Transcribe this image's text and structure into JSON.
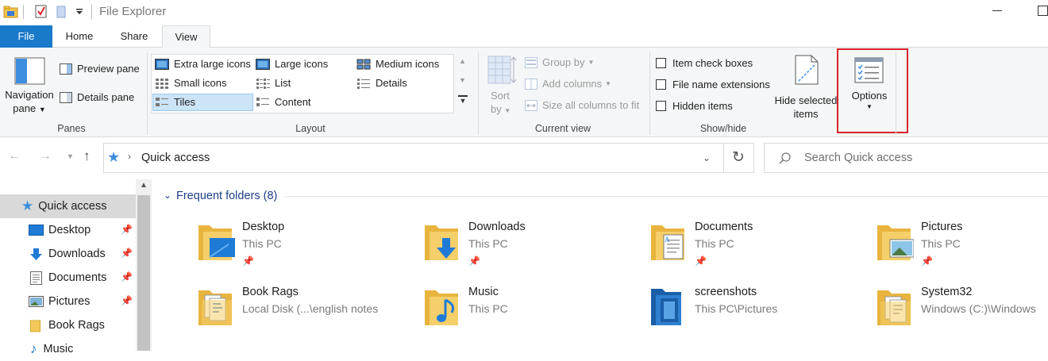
{
  "window": {
    "title": "File Explorer"
  },
  "tabs": [
    {
      "label": "File"
    },
    {
      "label": "Home"
    },
    {
      "label": "Share"
    },
    {
      "label": "View"
    }
  ],
  "ribbon": {
    "panes": {
      "nav_pane_line1": "Navigation",
      "nav_pane_line2": "pane",
      "preview_pane": "Preview pane",
      "details_pane": "Details pane",
      "group_label": "Panes"
    },
    "layout": {
      "items": [
        {
          "label": "Extra large icons"
        },
        {
          "label": "Large icons"
        },
        {
          "label": "Medium icons"
        },
        {
          "label": "Small icons"
        },
        {
          "label": "List"
        },
        {
          "label": "Details"
        },
        {
          "label": "Tiles"
        },
        {
          "label": "Content"
        }
      ],
      "selected": "Tiles",
      "group_label": "Layout"
    },
    "current_view": {
      "sort_line1": "Sort",
      "sort_line2": "by",
      "group_by": "Group by",
      "add_columns": "Add columns",
      "size_all_columns": "Size all columns to fit",
      "group_label": "Current view"
    },
    "show_hide": {
      "item_check_boxes": "Item check boxes",
      "file_name_extensions": "File name extensions",
      "hidden_items": "Hidden items",
      "hide_selected_line1": "Hide selected",
      "hide_selected_line2": "items",
      "group_label": "Show/hide"
    },
    "options": {
      "label": "Options"
    },
    "highlight_color": "#d9232e"
  },
  "address": {
    "path": "Quick access"
  },
  "search": {
    "placeholder": "Search Quick access"
  },
  "nav": {
    "items": [
      {
        "label": "Quick access",
        "icon": "star-icon"
      },
      {
        "label": "Desktop",
        "icon": "desktop-icon"
      },
      {
        "label": "Downloads",
        "icon": "download-arrow-icon"
      },
      {
        "label": "Documents",
        "icon": "documents-icon"
      },
      {
        "label": "Pictures",
        "icon": "pictures-icon"
      },
      {
        "label": "Book Rags",
        "icon": "folder-icon"
      },
      {
        "label": "Music",
        "icon": "music-icon"
      }
    ]
  },
  "content": {
    "section_title": "Frequent folders (8)",
    "folders": [
      {
        "name": "Desktop",
        "location": "This PC",
        "pinned": true,
        "icon": "desktop-folder-icon"
      },
      {
        "name": "Downloads",
        "location": "This PC",
        "pinned": true,
        "icon": "downloads-folder-icon"
      },
      {
        "name": "Documents",
        "location": "This PC",
        "pinned": true,
        "icon": "documents-folder-icon"
      },
      {
        "name": "Pictures",
        "location": "This PC",
        "pinned": true,
        "icon": "pictures-folder-icon"
      },
      {
        "name": "Book Rags",
        "location": "Local Disk (...\\english notes",
        "pinned": false,
        "icon": "folder-icon"
      },
      {
        "name": "Music",
        "location": "This PC",
        "pinned": false,
        "icon": "music-folder-icon"
      },
      {
        "name": "screenshots",
        "location": "This PC\\Pictures",
        "pinned": false,
        "icon": "screenshots-folder-icon"
      },
      {
        "name": "System32",
        "location": "Windows (C:)\\Windows",
        "pinned": false,
        "icon": "system-folder-icon"
      }
    ]
  },
  "colors": {
    "file_tab": "#1979ca",
    "accent_blue": "#1e5aa8",
    "folder_yellow": "#f4c95a"
  }
}
